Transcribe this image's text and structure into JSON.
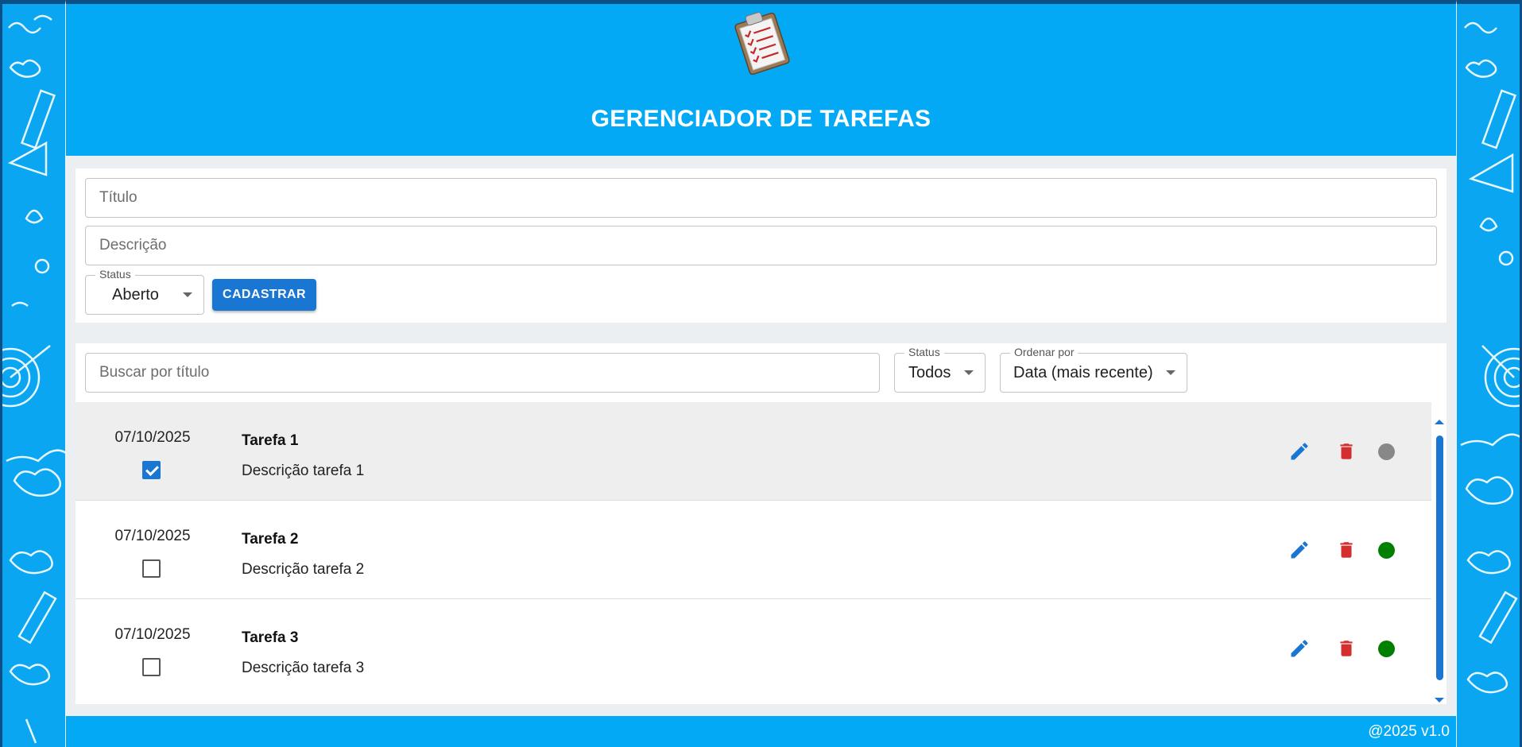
{
  "app": {
    "title": "GERENCIADOR DE TAREFAS",
    "logo_icon": "clipboard-checklist-icon",
    "footer": "@2025 v1.0"
  },
  "colors": {
    "brand": "#03a9f4",
    "primary": "#1976d2",
    "danger": "#d32f2f",
    "status_open": "#888888",
    "status_done": "#008000"
  },
  "form": {
    "title_placeholder": "Título",
    "description_placeholder": "Descrição",
    "status_label": "Status",
    "status_value": "Aberto",
    "submit_label": "CADASTRAR"
  },
  "filters": {
    "search_placeholder": "Buscar por título",
    "status_label": "Status",
    "status_value": "Todos",
    "sort_label": "Ordenar por",
    "sort_value": "Data (mais recente)"
  },
  "tasks": [
    {
      "date": "07/10/2025",
      "title": "Tarefa 1",
      "description": "Descrição tarefa 1",
      "checked": true,
      "status_color": "#888888"
    },
    {
      "date": "07/10/2025",
      "title": "Tarefa 2",
      "description": "Descrição tarefa 2",
      "checked": false,
      "status_color": "#008000"
    },
    {
      "date": "07/10/2025",
      "title": "Tarefa 3",
      "description": "Descrição tarefa 3",
      "checked": false,
      "status_color": "#008000"
    }
  ]
}
